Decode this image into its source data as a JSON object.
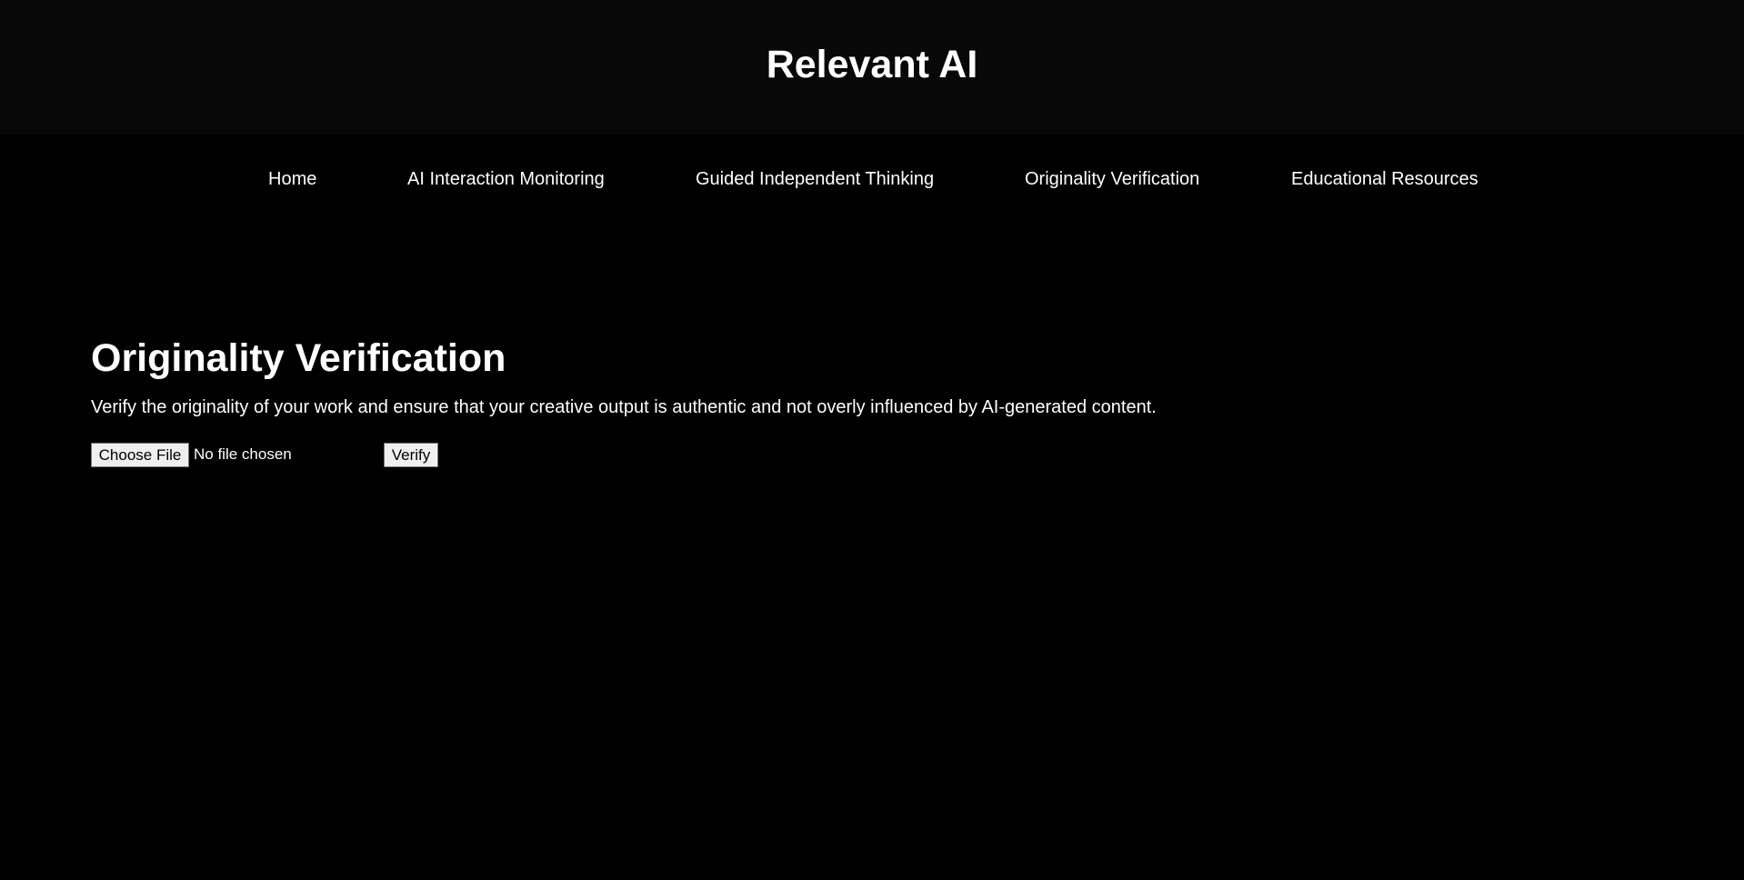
{
  "header": {
    "title": "Relevant AI"
  },
  "nav": {
    "items": [
      {
        "label": "Home"
      },
      {
        "label": "AI Interaction Monitoring"
      },
      {
        "label": "Guided Independent Thinking"
      },
      {
        "label": "Originality Verification"
      },
      {
        "label": "Educational Resources"
      }
    ]
  },
  "section": {
    "title": "Originality Verification",
    "description": "Verify the originality of your work and ensure that your creative output is authentic and not overly influenced by AI-generated content.",
    "file_input": {
      "button_label": "Choose File",
      "status": "No file chosen"
    },
    "verify_label": "Verify"
  },
  "colors": {
    "page_background": "#000000",
    "header_background": "#080808",
    "text": "#ffffff",
    "button_background": "#efefef"
  }
}
